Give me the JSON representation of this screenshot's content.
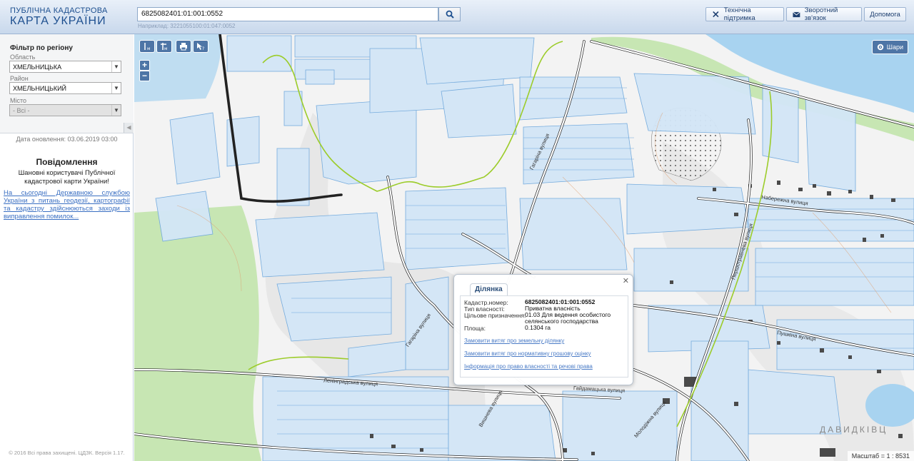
{
  "header": {
    "logo_line1": "ПУБЛІЧНА КАДАСТРОВА",
    "logo_line2": "КАРТА УКРАЇНИ",
    "search_value": "6825082401:01:001:0552",
    "search_hint": "Наприклад: 3221055100:01:047:0052",
    "tech_support": "Технічна підтримка",
    "feedback": "Зворотний зв'язок",
    "help": "Допомога"
  },
  "sidebar": {
    "filter_title": "Фільтр по регіону",
    "oblast_label": "Область",
    "oblast_value": "ХМЕЛЬНИЦЬКА",
    "raion_label": "Район",
    "raion_value": "ХМЕЛЬНИЦЬКИЙ",
    "city_label": "Місто",
    "city_value": "- Всі -",
    "update_date": "Дата оновлення: 03.06.2019 03:00",
    "notice_title": "Повідомлення",
    "notice_text": "Шановні користувачі Публічної кадастрової карти України!",
    "notice_link": "На сьогодні Державною службою України з питань геодезії, картографії та кадастру здійснюються заходи із виправлення помилок...",
    "copyright": "© 2016 Всі права захищені. ЦДЗК. Версія 1.17."
  },
  "map": {
    "layers_label": "Шари",
    "scale_label": "Масштаб = 1 : 8531",
    "village_label": "ДАВИДКІВЦ",
    "streets": [
      "Набережна вулиця",
      "Першотравнева вулиця",
      "Гагаріна вулиця",
      "Гагаріна вулиця",
      "Ленінградська вулиця",
      "Гайдамацька вулиця",
      "Вишнева вулиця",
      "Пушкіна вулиця",
      "Молодіжна вулиця"
    ]
  },
  "popup": {
    "tab": "Ділянка",
    "cadastral_label": "Кадастр.номер:",
    "cadastral_value": "6825082401:01:001:0552",
    "ownership_label": "Тип власності:",
    "ownership_value": "Приватна власність",
    "purpose_label": "Цільове призначення:",
    "purpose_value": "01.03 Для ведення особистого селянського господарства",
    "area_label": "Площа:",
    "area_value": "0.1304 га",
    "link1": "Замовити витяг про земельну ділянку",
    "link2": "Замовити витяг про нормативну грошову оцінку",
    "link3": "Інформація про право власності та речові права"
  },
  "colors": {
    "parcel_fill": "#d3e6f7",
    "parcel_stroke": "#6fa8dc",
    "water": "#a8d3f0",
    "green": "#c7e6b3",
    "boundary": "#9ccc2a",
    "accent": "#4e75a6"
  }
}
